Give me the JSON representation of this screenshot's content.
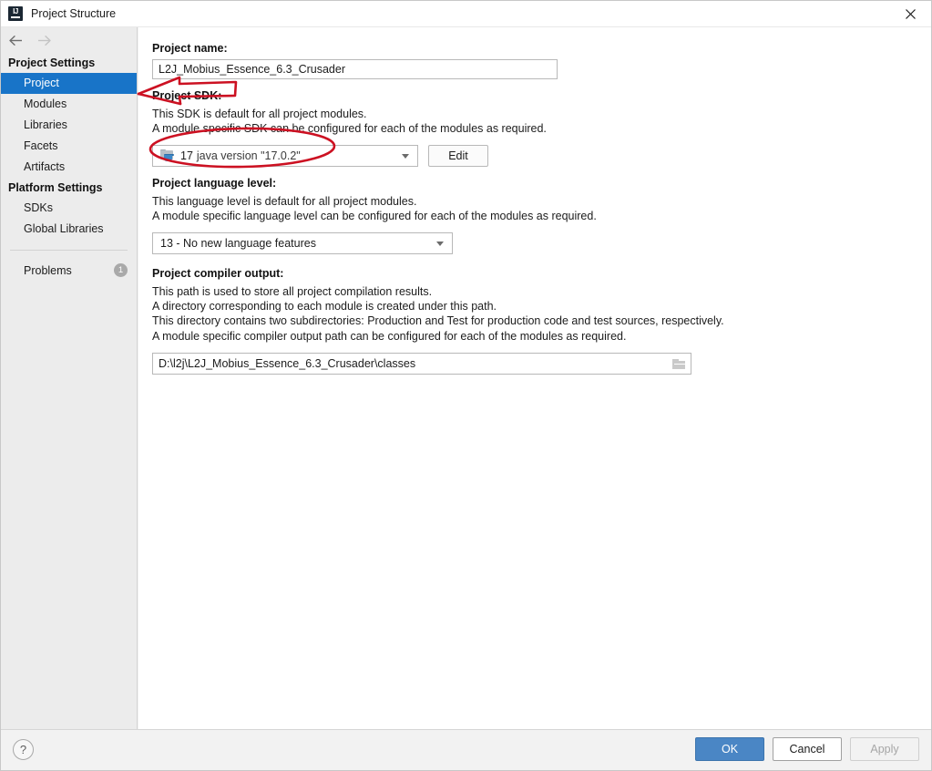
{
  "window": {
    "title": "Project Structure",
    "app_icon": "intellij-idea-icon",
    "close_label": "×"
  },
  "nav": {
    "back_label": "back-arrow",
    "forward_label": "forward-arrow"
  },
  "sidebar": {
    "project_settings_header": "Project Settings",
    "project_settings_items": [
      {
        "label": "Project",
        "selected": true
      },
      {
        "label": "Modules",
        "selected": false
      },
      {
        "label": "Libraries",
        "selected": false
      },
      {
        "label": "Facets",
        "selected": false
      },
      {
        "label": "Artifacts",
        "selected": false
      }
    ],
    "platform_settings_header": "Platform Settings",
    "platform_settings_items": [
      {
        "label": "SDKs",
        "selected": false
      },
      {
        "label": "Global Libraries",
        "selected": false
      }
    ],
    "problems": {
      "label": "Problems",
      "count": "1"
    }
  },
  "main": {
    "project_name": {
      "label": "Project name:",
      "value": "L2J_Mobius_Essence_6.3_Crusader",
      "placeholder": ""
    },
    "project_sdk": {
      "label": "Project SDK:",
      "description_lines": [
        "This SDK is default for all project modules.",
        "A module specific SDK can be configured for each of the modules as required."
      ],
      "selected_version": "17",
      "selected_description": "java version \"17.0.2\"",
      "icon": "jdk-folder-icon",
      "edit_button_label": "Edit"
    },
    "project_language_level": {
      "label": "Project language level:",
      "description_lines": [
        "This language level is default for all project modules.",
        "A module specific language level can be configured for each of the modules as required."
      ],
      "selected_value": "13 - No new language features"
    },
    "project_compiler_output": {
      "label": "Project compiler output:",
      "description_lines": [
        "This path is used to store all project compilation results.",
        "A directory corresponding to each module is created under this path.",
        "This directory contains two subdirectories: Production and Test for production code and test sources, respectively.",
        "A module specific compiler output path can be configured for each of the modules as required."
      ],
      "value": "D:\\l2j\\L2J_Mobius_Essence_6.3_Crusader\\classes",
      "browse_icon": "folder-browse-icon"
    }
  },
  "footer": {
    "help_label": "?",
    "ok_label": "OK",
    "cancel_label": "Cancel",
    "apply_label": "Apply"
  },
  "annotations": {
    "arrow": "red-arrow-pointing-left",
    "ellipse": "red-ellipse-around-sdk-combo",
    "color": "#cc1122"
  },
  "colors": {
    "selection_blue": "#1874c8",
    "ok_blue": "#4a86c5",
    "annotation_red": "#cc1122",
    "sidebar_bg": "#ececec",
    "footer_bg": "#f2f2f2"
  }
}
